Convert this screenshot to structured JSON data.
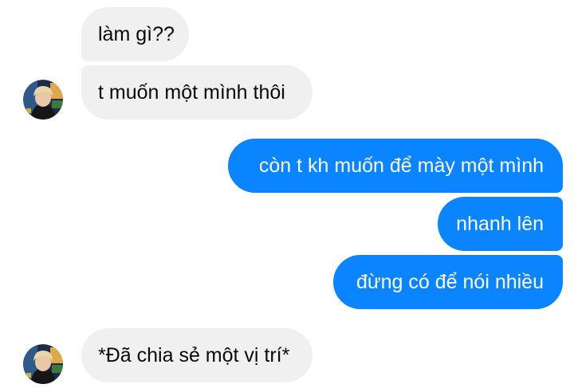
{
  "conversation": {
    "messages": [
      {
        "sender": "other",
        "text": "làm gì??"
      },
      {
        "sender": "other",
        "text": "t muốn một mình thôi"
      },
      {
        "sender": "self",
        "text": "còn t kh muốn để mày một mình"
      },
      {
        "sender": "self",
        "text": "nhanh lên"
      },
      {
        "sender": "self",
        "text": "đừng có để nói nhiều"
      },
      {
        "sender": "other",
        "text": "*Đã chia sẻ một vị trí*"
      }
    ]
  },
  "colors": {
    "incoming_bubble": "#f0f0f1",
    "outgoing_bubble": "#0a84ff",
    "incoming_text": "#0a0a0a",
    "outgoing_text": "#ffffff"
  },
  "icons": {
    "contact_avatar": "avatar-photo"
  }
}
